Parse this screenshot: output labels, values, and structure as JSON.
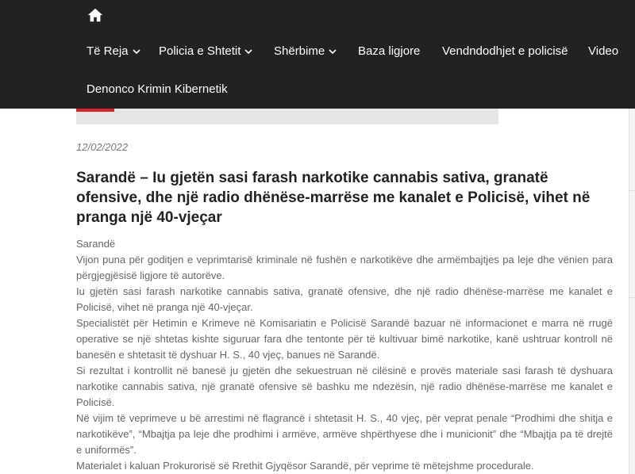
{
  "nav": {
    "home_icon": "home-icon",
    "items": [
      {
        "label": "Të Reja",
        "dropdown": true
      },
      {
        "label": "Policia e Shtetit",
        "dropdown": true
      },
      {
        "label": "Shërbime",
        "dropdown": true
      },
      {
        "label": "Baza ligjore",
        "dropdown": false
      },
      {
        "label": "Vendndodhjet e policisë",
        "dropdown": false
      },
      {
        "label": "Video",
        "dropdown": false
      }
    ],
    "second_row": "Denonco Krimin Kibernetik"
  },
  "article": {
    "date": "12/02/2022",
    "title": "Sarandë – Iu gjetën sasi farash narkotike cannabis sativa, granatë ofensive, dhe një radio dhënëse-marrëse me kanalet e Policisë, vihet në pranga një 40-vjeçar",
    "paragraphs": [
      "Sarandë",
      "Vijon puna për goditjen e veprimtarisë kriminale në fushën e narkotikëve dhe armëmbajtjes pa leje dhe vënien para përgjegjësisë ligjore të autorëve.",
      "Iu gjetën sasi farash narkotike cannabis sativa, granatë ofensive, dhe një radio dhënëse-marrëse me kanalet e Policisë, vihet në pranga një 40-vjeçar.",
      "Specialistët për Hetimin e Krimeve në Komisariatin e Policisë Sarandë bazuar në informacionet e marra në rrugë operative se një shtetas kishte siguruar fara dhe tentonte për të kultivuar bimë narkotike, kanë ushtruar kontroll në banesën e shtetasit të dyshuar H. S., 40 vjeç, banues në Sarandë.",
      "Si rezultat i kontrollit në banesë ju gjetën dhe sekuestruan në cilësinë e provës materiale sasi farash të dyshuara narkotike cannabis sativa, një granatë ofensive së bashku me ndezësin, një radio dhënëse-marrëse me kanalet e Policisë.",
      "Në vijim të veprimeve u bë arrestimi në flagrancë i shtetasit H. S., 40 vjeç, për veprat penale “Prodhimi dhe shitja e narkotikëve”, “Mbajtja pa leje dhe prodhimi i armëve, armëve shpërthyese dhe i municionit” dhe “Mbajtja pa të drejtë e uniformës”.",
      "Materialet i kaluan Prokurorisë së Rrethit Gjyqësor Sarandë, për veprime të mëtejshme procedurale."
    ]
  },
  "colors": {
    "header_bg": "#222222",
    "accent": "#d9232d",
    "body_text": "#666666",
    "title_text": "#222222"
  }
}
